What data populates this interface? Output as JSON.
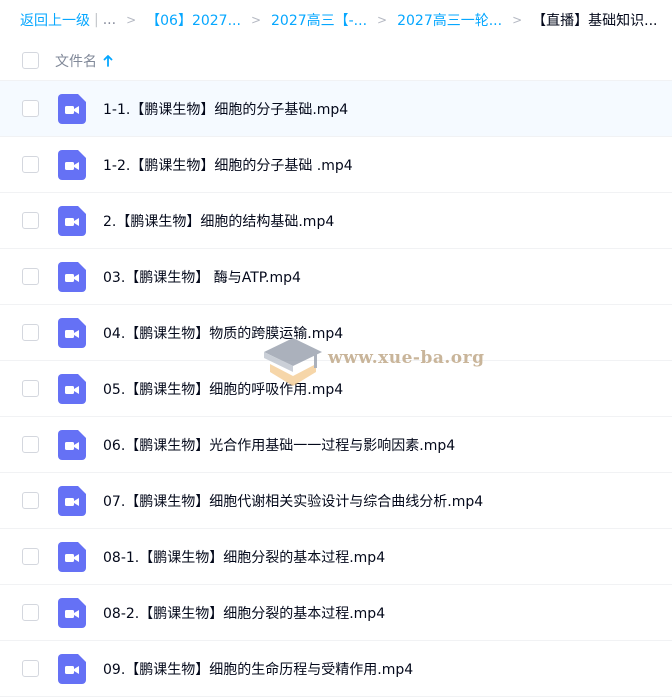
{
  "breadcrumb": {
    "back": "返回上一级",
    "ellipsis": "...",
    "items": [
      "【06】2027...",
      "2027高三【-...",
      "2027高三一轮...",
      "【直播】基础知识..."
    ]
  },
  "header": {
    "column_name": "文件名"
  },
  "files": [
    "1-1.【鹏课生物】细胞的分子基础.mp4",
    "1-2.【鹏课生物】细胞的分子基础 .mp4",
    "2.【鹏课生物】细胞的结构基础.mp4",
    "03.【鹏课生物】 酶与ATP.mp4",
    "04.【鹏课生物】物质的跨膜运输.mp4",
    "05.【鹏课生物】细胞的呼吸作用.mp4",
    "06.【鹏课生物】光合作用基础一一过程与影响因素.mp4",
    "07.【鹏课生物】细胞代谢相关实验设计与综合曲线分析.mp4",
    "08-1.【鹏课生物】细胞分裂的基本过程.mp4",
    "08-2.【鹏课生物】细胞分裂的基本过程.mp4",
    "09.【鹏课生物】细胞的生命历程与受精作用.mp4"
  ],
  "file_icon": "video-file-icon",
  "watermark": {
    "text": "www.xue-ba.org"
  },
  "colors": {
    "accent": "#06a7ff",
    "video_icon": "#6571f5",
    "hover_row": "#f5faff"
  }
}
